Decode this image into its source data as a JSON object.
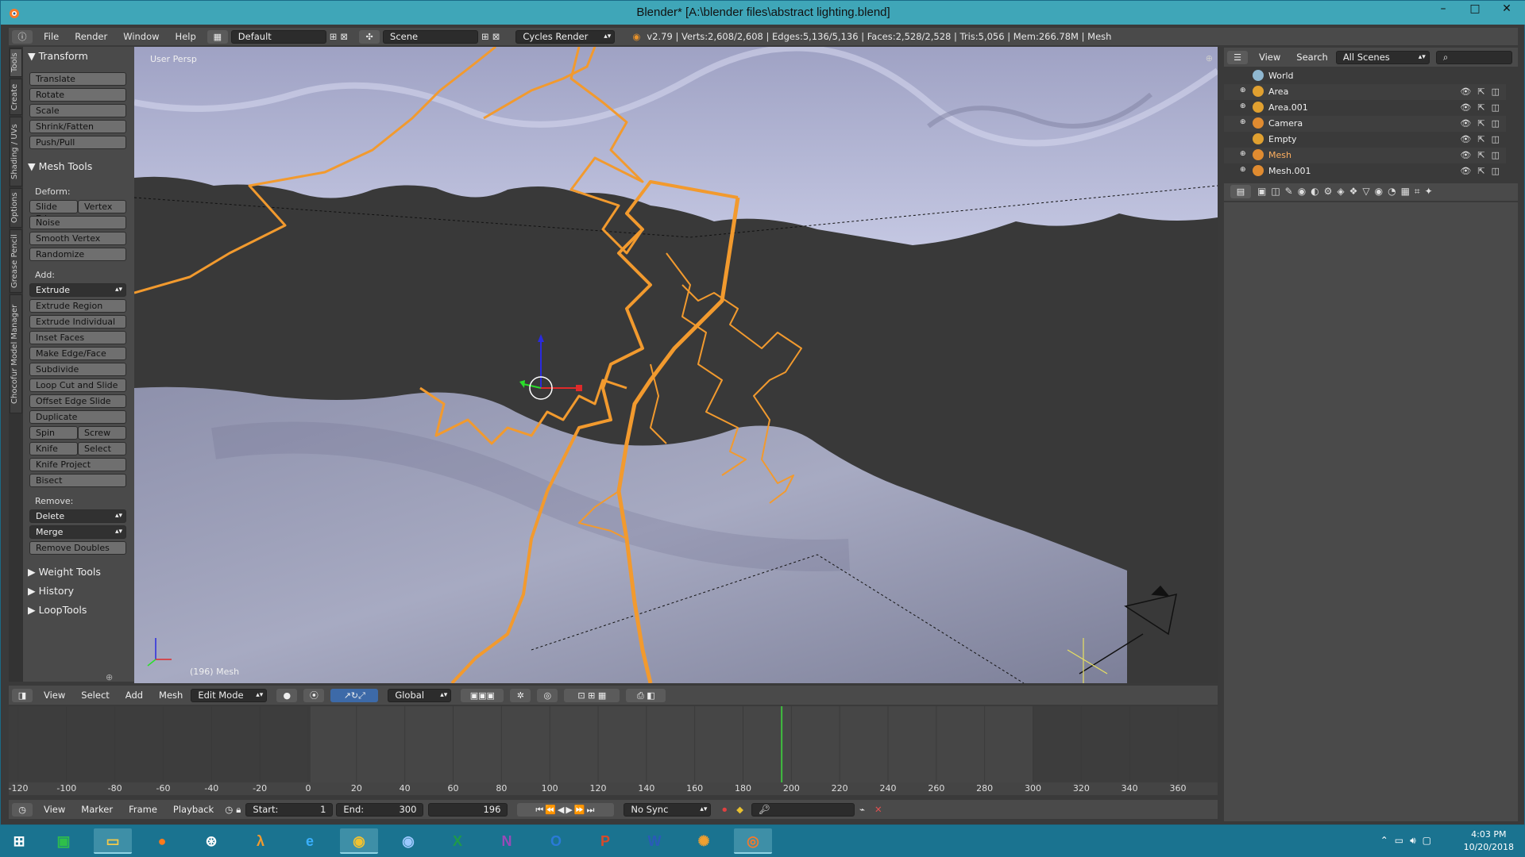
{
  "window": {
    "title": "Blender* [A:\\blender files\\abstract lighting.blend]",
    "minimize": "–",
    "maximize": "□",
    "close": "✕"
  },
  "info": {
    "menus": [
      "File",
      "Render",
      "Window",
      "Help"
    ],
    "screen_layout": "Default",
    "scene": "Scene",
    "render_engine": "Cycles Render",
    "stats": "v2.79 | Verts:2,608/2,608 | Edges:5,136/5,136 | Faces:2,528/2,528 | Tris:5,056 | Mem:266.78M | Mesh"
  },
  "tabs": [
    "Tools",
    "Create",
    "Shading / UVs",
    "Options",
    "Grease Pencil",
    "Chocofur Model Manager"
  ],
  "tools": {
    "transform_header": "Transform",
    "transform": [
      "Translate",
      "Rotate",
      "Scale",
      "Shrink/Fatten",
      "Push/Pull"
    ],
    "mesh_tools_header": "Mesh Tools",
    "deform_label": "Deform:",
    "slide_edge": "Slide Edge",
    "vertex": "Vertex",
    "deform": [
      "Noise",
      "Smooth Vertex",
      "Randomize"
    ],
    "add_label": "Add:",
    "extrude": "Extrude",
    "add": [
      "Extrude Region",
      "Extrude Individual",
      "Inset Faces",
      "Make Edge/Face",
      "Subdivide",
      "Loop Cut and Slide",
      "Offset Edge Slide",
      "Duplicate"
    ],
    "spin": "Spin",
    "screw": "Screw",
    "knife": "Knife",
    "select": "Select",
    "add2": [
      "Knife Project",
      "Bisect"
    ],
    "remove_label": "Remove:",
    "delete": "Delete",
    "merge": "Merge",
    "remove_doubles": "Remove Doubles",
    "weight_tools": "Weight Tools",
    "history": "History",
    "loop_tools": "LoopTools"
  },
  "viewport": {
    "view_name": "User Persp",
    "object_info": "(196) Mesh"
  },
  "view3d_header": {
    "menus": [
      "View",
      "Select",
      "Add",
      "Mesh"
    ],
    "mode": "Edit Mode",
    "orientation": "Global"
  },
  "timeline": {
    "ticks": [
      "-120",
      "-100",
      "-80",
      "-60",
      "-40",
      "-20",
      "0",
      "20",
      "40",
      "60",
      "80",
      "100",
      "120",
      "140",
      "160",
      "180",
      "200",
      "220",
      "240",
      "260",
      "280",
      "300",
      "320",
      "340",
      "360"
    ],
    "current_frame_value": 196,
    "menus": [
      "View",
      "Marker",
      "Frame",
      "Playback"
    ],
    "start_label": "Start:",
    "start": "1",
    "end_label": "End:",
    "end": "300",
    "current": "196",
    "sync": "No Sync"
  },
  "outliner": {
    "menus": [
      "View",
      "Search"
    ],
    "display": "All Scenes",
    "items": [
      {
        "name": "World",
        "icon_color": "#8fb7d0"
      },
      {
        "name": "Area",
        "icon_color": "#e0a030"
      },
      {
        "name": "Area.001",
        "icon_color": "#e0a030"
      },
      {
        "name": "Camera",
        "icon_color": "#e08b30"
      },
      {
        "name": "Empty",
        "icon_color": "#e0a030"
      },
      {
        "name": "Mesh",
        "icon_color": "#e08b30"
      },
      {
        "name": "Mesh.001",
        "icon_color": "#e08b30"
      }
    ]
  },
  "taskbar": {
    "apps": [
      "start-icon",
      "store-icon",
      "file-explorer-icon",
      "firefox-icon",
      "steam-icon",
      "half-life-icon",
      "edge-icon",
      "chrome-icon",
      "chrome-alt-icon",
      "excel-icon",
      "onenote-icon",
      "outlook-icon",
      "powerpoint-icon",
      "word-icon",
      "color-picker-icon",
      "blender-icon"
    ],
    "time": "4:03 PM",
    "date": "10/20/2018"
  },
  "colors": {
    "accent": "#e8922a",
    "lightning": "#f29a2e",
    "terrain": "#8b8ea8",
    "sky": "#b9bcd8",
    "current_frame": "#3fbf3f"
  }
}
